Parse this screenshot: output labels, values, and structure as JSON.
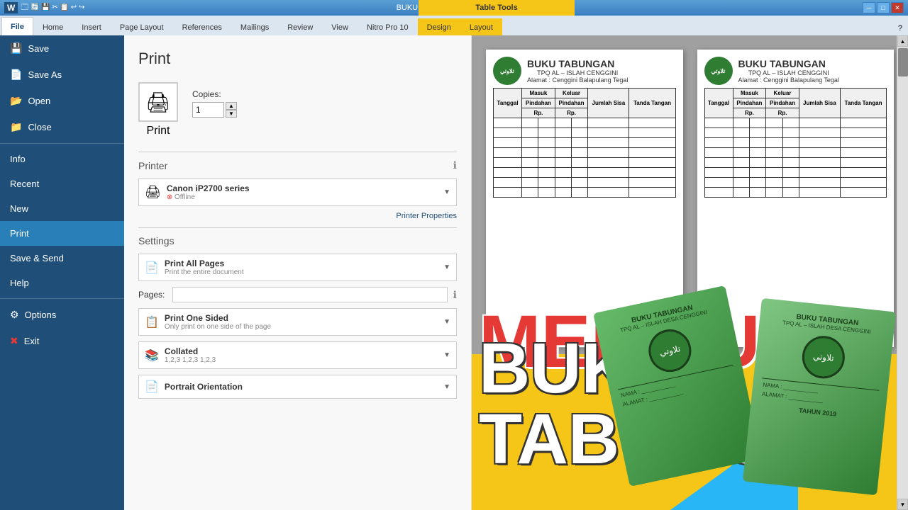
{
  "titlebar": {
    "title": "BUKU TABUNGAN DALAM - Microsoft Word",
    "app_icon": "W",
    "controls": [
      "minimize",
      "maximize",
      "close"
    ]
  },
  "table_tools": {
    "label": "Table Tools",
    "tabs": [
      "Design",
      "Layout"
    ]
  },
  "ribbon": {
    "tabs": [
      "File",
      "Home",
      "Insert",
      "Page Layout",
      "References",
      "Mailings",
      "Review",
      "View",
      "Nitro Pro 10",
      "Design",
      "Layout"
    ],
    "active_tab": "File"
  },
  "sidebar": {
    "items": [
      {
        "id": "save",
        "label": "Save",
        "icon": "💾"
      },
      {
        "id": "save-as",
        "label": "Save As",
        "icon": "📄"
      },
      {
        "id": "open",
        "label": "Open",
        "icon": "📂"
      },
      {
        "id": "close",
        "label": "Close",
        "icon": "📁"
      },
      {
        "id": "info",
        "label": "Info"
      },
      {
        "id": "recent",
        "label": "Recent"
      },
      {
        "id": "new",
        "label": "New"
      },
      {
        "id": "print",
        "label": "Print"
      },
      {
        "id": "save-send",
        "label": "Save & Send"
      },
      {
        "id": "help",
        "label": "Help"
      },
      {
        "id": "options",
        "label": "Options",
        "icon": "⚙"
      },
      {
        "id": "exit",
        "label": "Exit",
        "icon": "✖"
      }
    ],
    "active": "print"
  },
  "print_panel": {
    "title": "Print",
    "print_button_label": "Print",
    "copies_label": "Copies:",
    "copies_value": "1",
    "printer_section_label": "Printer",
    "printer_name": "Canon iP2700 series",
    "printer_status": "Offline",
    "printer_properties_link": "Printer Properties",
    "settings_section_label": "Settings",
    "setting1_name": "Print All Pages",
    "setting1_desc": "Print the entire document",
    "pages_label": "Pages:",
    "setting2_name": "Print One Sided",
    "setting2_desc": "Only print on one side of the page",
    "setting3_name": "Collated",
    "setting3_desc": "1,2,3  1,2,3  1,2,3",
    "setting4_name": "Portrait Orientation"
  },
  "document": {
    "page1": {
      "title": "BUKU TABUNGAN",
      "subtitle1": "TPQ AL – ISLAH CENGGINI",
      "subtitle2": "Alamat : Cenggini Balapulang Tegal",
      "columns": [
        "Tanggal",
        "Masuk",
        "Keluar",
        "Jumlah Sisa",
        "Tanda Tangan"
      ],
      "subcolumns": [
        "Pindahan",
        "Pindahan",
        "",
        ""
      ],
      "subcolumns2": [
        "Rp.",
        "Rp.",
        "Rp.",
        ""
      ]
    },
    "page2": {
      "title": "BUKU TABUNGAN",
      "subtitle1": "TPQ AL – ISLAH CENGGINI",
      "subtitle2": "Alamat : Cenggini Balapulang Tegal"
    }
  },
  "overlay": {
    "membuat_text": "MEMBUAT",
    "buku_text": "BUKU TABUNGAN",
    "booklet1": {
      "title": "BUKU TABUNGAN",
      "subtitle": "TPQ AL – ISLAH DESA CENGGINI",
      "field_nama": "NAMA",
      "field_alamat": "ALAMAT"
    },
    "booklet2": {
      "title": "BUKU TABUNGAN",
      "subtitle": "TPQ AL – ISLAH DESA CENGGINI",
      "field_nama": "NAMA",
      "field_alamat": "ALAMAT",
      "year": "TAHUN 2019"
    }
  }
}
